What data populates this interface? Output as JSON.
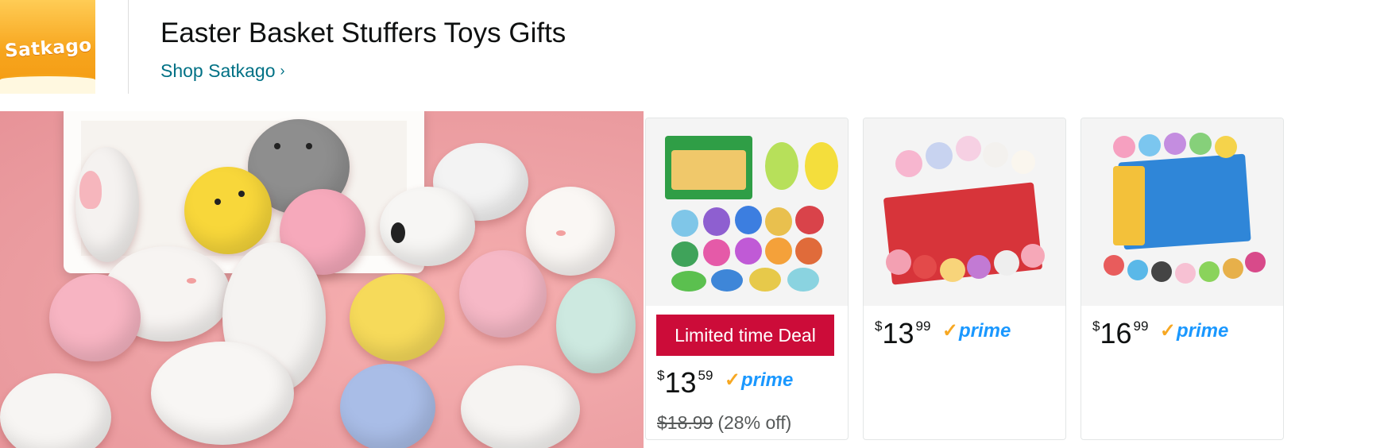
{
  "brand": {
    "logo_text": "Satkago",
    "title": "Easter Basket Stuffers Toys Gifts",
    "shop_link": "Shop Satkago",
    "shop_chevron": "›"
  },
  "products": [
    {
      "badge": "Limited time Deal",
      "currency": "$",
      "price_whole": "13",
      "price_fraction": "59",
      "prime_check": "✓",
      "prime_label": "prime",
      "list_price": "$18.99",
      "discount": "(28% off)"
    },
    {
      "currency": "$",
      "price_whole": "13",
      "price_fraction": "99",
      "prime_check": "✓",
      "prime_label": "prime"
    },
    {
      "currency": "$",
      "price_whole": "16",
      "price_fraction": "99",
      "prime_check": "✓",
      "prime_label": "prime"
    }
  ],
  "colors": {
    "link": "#007185",
    "deal_badge": "#cc0c39",
    "prime_blue": "#1a98ff",
    "prime_check": "#f7a823",
    "logo_orange": "#f7a51d"
  }
}
